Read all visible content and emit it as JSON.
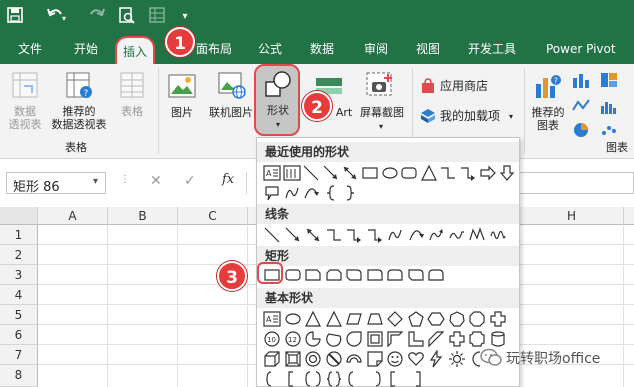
{
  "quick_access": {
    "save": "save-icon",
    "undo": "undo-icon",
    "redo": "redo-icon",
    "preview": "print-preview-icon",
    "custom": "customize-icon",
    "more": "▾"
  },
  "tabs": [
    "文件",
    "开始",
    "插入",
    "页面布局",
    "公式",
    "数据",
    "审阅",
    "视图",
    "开发工具",
    "Power Pivot"
  ],
  "tab_partial": "面布局",
  "ribbon": {
    "tables_group": {
      "label": "表格",
      "pivot": "数据\n透视表",
      "recommended_pivot": "推荐的\n数据透视表",
      "table": "表格"
    },
    "illustrations": {
      "picture": "图片",
      "online_picture": "联机图片",
      "shapes": "形状",
      "smartart_partial": "Art",
      "screenshot": "屏幕截图"
    },
    "addins": {
      "store": "应用商店",
      "my_addins": "我的加载项"
    },
    "charts": {
      "recommended": "推荐的\n图表",
      "group_partial": "图表"
    }
  },
  "callouts": [
    "1",
    "2",
    "3"
  ],
  "formula_bar": {
    "name_box": "矩形 86",
    "cancel": "✕",
    "enter": "✓",
    "fx": "fx"
  },
  "grid": {
    "columns": [
      "A",
      "B",
      "C",
      "H"
    ],
    "rows": [
      "1",
      "2",
      "3",
      "4",
      "5",
      "6",
      "7",
      "8"
    ]
  },
  "shapes_menu": {
    "recent": "最近使用的形状",
    "lines": "线条",
    "rectangles": "矩形",
    "basic": "基本形状"
  },
  "watermark": "玩转职场office"
}
